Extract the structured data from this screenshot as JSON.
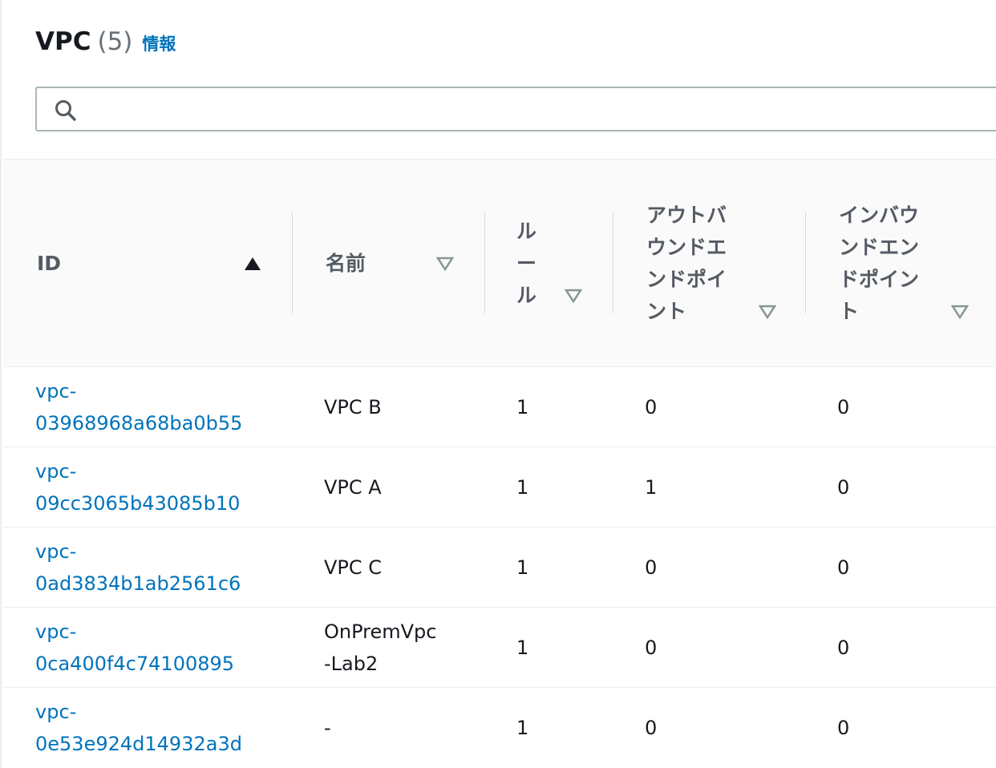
{
  "header": {
    "title": "VPC",
    "count": "(5)",
    "info_link": "情報"
  },
  "search": {
    "placeholder": "",
    "value": ""
  },
  "columns": [
    {
      "label": "ID",
      "sort": "ascending"
    },
    {
      "label": "名前",
      "sort": "none"
    },
    {
      "label": "ル\nー\nル",
      "sort": "none"
    },
    {
      "label": "アウトバ\nウンドエ\nンドポイ\nント",
      "sort": "none"
    },
    {
      "label": "インバウ\nンドエン\nドポイン\nト",
      "sort": "none"
    }
  ],
  "rows": [
    {
      "id": "vpc-\n03968968a68ba0b55",
      "name": "VPC B",
      "rules": "1",
      "outbound": "0",
      "inbound": "0"
    },
    {
      "id": "vpc-\n09cc3065b43085b10",
      "name": "VPC A",
      "rules": "1",
      "outbound": "1",
      "inbound": "0"
    },
    {
      "id": "vpc-\n0ad3834b1ab2561c6",
      "name": "VPC C",
      "rules": "1",
      "outbound": "0",
      "inbound": "0"
    },
    {
      "id": "vpc-\n0ca400f4c74100895",
      "name": "OnPremVpc\n-Lab2",
      "rules": "1",
      "outbound": "0",
      "inbound": "0"
    },
    {
      "id": "vpc-\n0e53e924d14932a3d",
      "name": "-",
      "rules": "1",
      "outbound": "0",
      "inbound": "0"
    }
  ],
  "colors": {
    "link": "#0073bb",
    "text": "#16191f",
    "header_text": "#545b64",
    "header_bg": "#fafafa"
  }
}
